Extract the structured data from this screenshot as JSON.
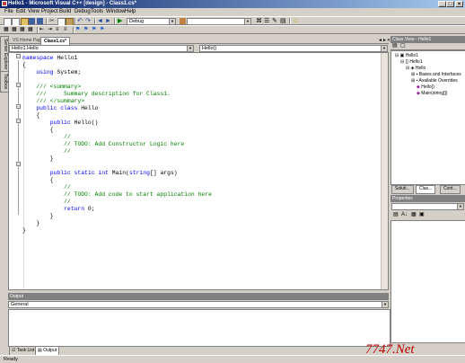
{
  "window": {
    "title": "Hello1 - Microsoft Visual C++ [design] - Class1.cs*"
  },
  "menu": [
    "File",
    "Edit",
    "View",
    "Project",
    "Build",
    "Debug",
    "Tools",
    "Window",
    "Help"
  ],
  "toolbar": {
    "config": "Debug",
    "find": ""
  },
  "left_tabs": [
    "Server Explorer",
    "Toolbox"
  ],
  "doc_tabs": [
    "VS Home Page",
    "Class1.cs*"
  ],
  "nav": {
    "class_combo": "Hello1.Hello",
    "member_combo": "Hello()"
  },
  "code_lines": [
    {
      "t": "namespace Hello1",
      "c": "kw-first"
    },
    {
      "t": "{",
      "c": "pl"
    },
    {
      "t": "    using System;",
      "c": "using"
    },
    {
      "t": "",
      "c": "pl"
    },
    {
      "t": "    /// <summary>",
      "c": "cm"
    },
    {
      "t": "    ///     Summary description for Class1.",
      "c": "cm"
    },
    {
      "t": "    /// </summary>",
      "c": "cm"
    },
    {
      "t": "    public class Hello",
      "c": "pubclass"
    },
    {
      "t": "    {",
      "c": "pl"
    },
    {
      "t": "        public Hello()",
      "c": "pubctor"
    },
    {
      "t": "        {",
      "c": "pl"
    },
    {
      "t": "            //",
      "c": "cm"
    },
    {
      "t": "            // TODO: Add Constructor Logic here",
      "c": "cm"
    },
    {
      "t": "            //",
      "c": "cm"
    },
    {
      "t": "        }",
      "c": "pl"
    },
    {
      "t": "",
      "c": "pl"
    },
    {
      "t": "        public static int Main(string[] args)",
      "c": "main"
    },
    {
      "t": "        {",
      "c": "pl"
    },
    {
      "t": "            //",
      "c": "cm"
    },
    {
      "t": "            // TODO: Add code to start application here",
      "c": "cm"
    },
    {
      "t": "            //",
      "c": "cm"
    },
    {
      "t": "            return 0;",
      "c": "ret"
    },
    {
      "t": "        }",
      "c": "pl"
    },
    {
      "t": "    }",
      "c": "pl"
    },
    {
      "t": "}",
      "c": "pl"
    }
  ],
  "class_view": {
    "title": "Class View - Hello1",
    "nodes": [
      "Hello1",
      "Hello1",
      "Hello",
      "Bases and Interfaces",
      "Available Overrides",
      "Hello()",
      "Main(string[])"
    ],
    "tabs": [
      "Soluti...",
      "Clas...",
      "Cont..."
    ]
  },
  "properties": {
    "title": "Properties"
  },
  "output": {
    "title": "Output",
    "combo": "General"
  },
  "bottom_tabs": [
    "Task List",
    "Output"
  ],
  "status": {
    "text": "Ready"
  },
  "watermark": "7747.Net"
}
